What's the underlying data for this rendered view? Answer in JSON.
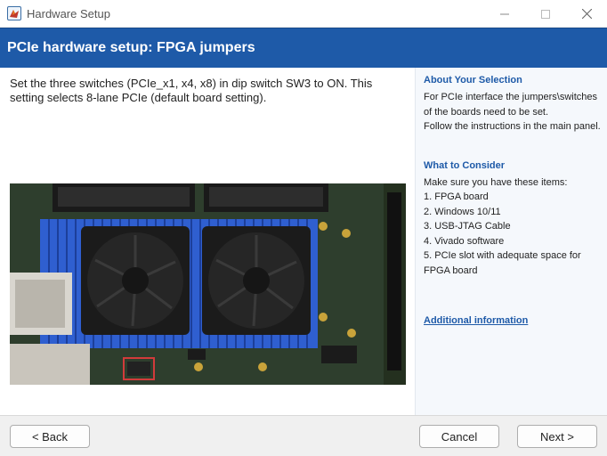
{
  "window": {
    "title": "Hardware Setup",
    "controls": {
      "minimize_icon": "minimize-icon",
      "maximize_icon": "maximize-icon",
      "close_icon": "close-icon"
    }
  },
  "header": {
    "title": "PCIe hardware setup: FPGA jumpers"
  },
  "main": {
    "instructions": "Set the three switches (PCIe_x1, x4, x8) in dip switch SW3 to ON. This setting selects 8-lane PCIe (default board setting).",
    "image_alt": "FPGA board with heatsink fans and dip switch SW3"
  },
  "sidepanel": {
    "about_title": "About Your Selection",
    "about_text": "For PCIe interface the jumpers\\switches of the boards need to be set.\n Follow the instructions in the main panel.",
    "consider_title": "What to Consider",
    "consider_intro": "Make sure you have these items:",
    "items": [
      "1. FPGA board",
      "2. Windows 10/11",
      "3. USB-JTAG Cable",
      "4. Vivado software",
      "5. PCIe slot with adequate space for FPGA board"
    ],
    "link": "Additional information"
  },
  "footer": {
    "back": "< Back",
    "cancel": "Cancel",
    "next": "Next >"
  },
  "colors": {
    "header_bg": "#1e5aa8",
    "accent": "#1e5aa8",
    "sidepanel_bg": "#f5f8fc",
    "footer_bg": "#f0f0f0"
  }
}
